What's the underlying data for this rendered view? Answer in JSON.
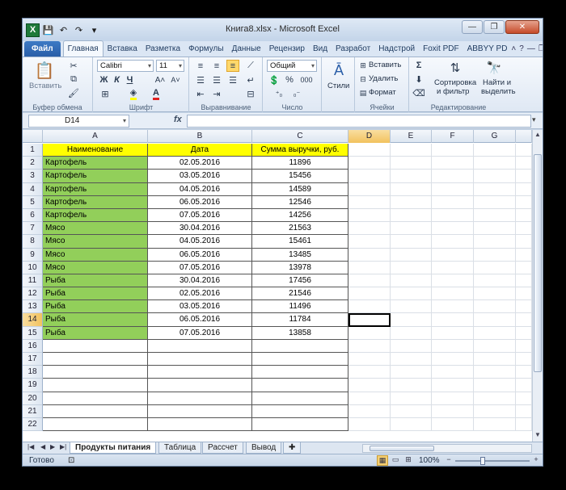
{
  "window": {
    "title": "Книга8.xlsx - Microsoft Excel",
    "logo_letter": "X"
  },
  "tabs": {
    "file": "Файл",
    "items": [
      "Главная",
      "Вставка",
      "Разметка",
      "Формулы",
      "Данные",
      "Рецензир",
      "Вид",
      "Разработ",
      "Надстрой",
      "Foxit PDF",
      "ABBYY PD"
    ],
    "active_index": 0
  },
  "ribbon": {
    "clipboard": {
      "paste_label": "Вставить",
      "group_label": "Буфер обмена"
    },
    "font": {
      "name": "Calibri",
      "size": "11",
      "group_label": "Шрифт",
      "bold": "Ж",
      "italic": "К",
      "underline": "Ч",
      "grow": "A˄",
      "shrink": "A˅"
    },
    "alignment": {
      "group_label": "Выравнивание"
    },
    "number": {
      "format": "Общий",
      "group_label": "Число",
      "percent": "%",
      "thousands": "000"
    },
    "styles": {
      "label": "Стили"
    },
    "cells": {
      "insert": "Вставить",
      "delete": "Удалить",
      "format": "Формат",
      "group_label": "Ячейки"
    },
    "editing": {
      "sigma": "Σ",
      "sort_line1": "Сортировка",
      "sort_line2": "и фильтр",
      "find_line1": "Найти и",
      "find_line2": "выделить",
      "group_label": "Редактирование"
    }
  },
  "formula_bar": {
    "name_box": "D14",
    "fx": "fx",
    "formula": ""
  },
  "grid": {
    "columns": [
      "A",
      "B",
      "C",
      "D",
      "E",
      "F",
      "G"
    ],
    "active_column": "D",
    "active_row": 14,
    "header": [
      "Наименование",
      "Дата",
      "Сумма выручки, руб."
    ],
    "rows": [
      [
        "Картофель",
        "02.05.2016",
        "11896"
      ],
      [
        "Картофель",
        "03.05.2016",
        "15456"
      ],
      [
        "Картофель",
        "04.05.2016",
        "14589"
      ],
      [
        "Картофель",
        "06.05.2016",
        "12546"
      ],
      [
        "Картофель",
        "07.05.2016",
        "14256"
      ],
      [
        "Мясо",
        "30.04.2016",
        "21563"
      ],
      [
        "Мясо",
        "04.05.2016",
        "15461"
      ],
      [
        "Мясо",
        "06.05.2016",
        "13485"
      ],
      [
        "Мясо",
        "07.05.2016",
        "13978"
      ],
      [
        "Рыба",
        "30.04.2016",
        "17456"
      ],
      [
        "Рыба",
        "02.05.2016",
        "21546"
      ],
      [
        "Рыба",
        "03.05.2016",
        "11496"
      ],
      [
        "Рыба",
        "06.05.2016",
        "11784"
      ],
      [
        "Рыба",
        "07.05.2016",
        "13858"
      ]
    ],
    "row_numbers": [
      "1",
      "2",
      "3",
      "4",
      "5",
      "6",
      "7",
      "8",
      "9",
      "10",
      "11",
      "12",
      "13",
      "14",
      "15",
      "16",
      "17",
      "18",
      "19",
      "20",
      "21",
      "22"
    ],
    "colors": {
      "name_fill": "#92cf5a",
      "header_fill": "#ffff00"
    }
  },
  "sheets": {
    "tabs": [
      "Продукты питания",
      "Таблица",
      "Рассчет",
      "Вывод"
    ],
    "active_index": 0
  },
  "status": {
    "text": "Готово",
    "zoom": "100%",
    "zoom_minus": "−",
    "zoom_plus": "+"
  }
}
